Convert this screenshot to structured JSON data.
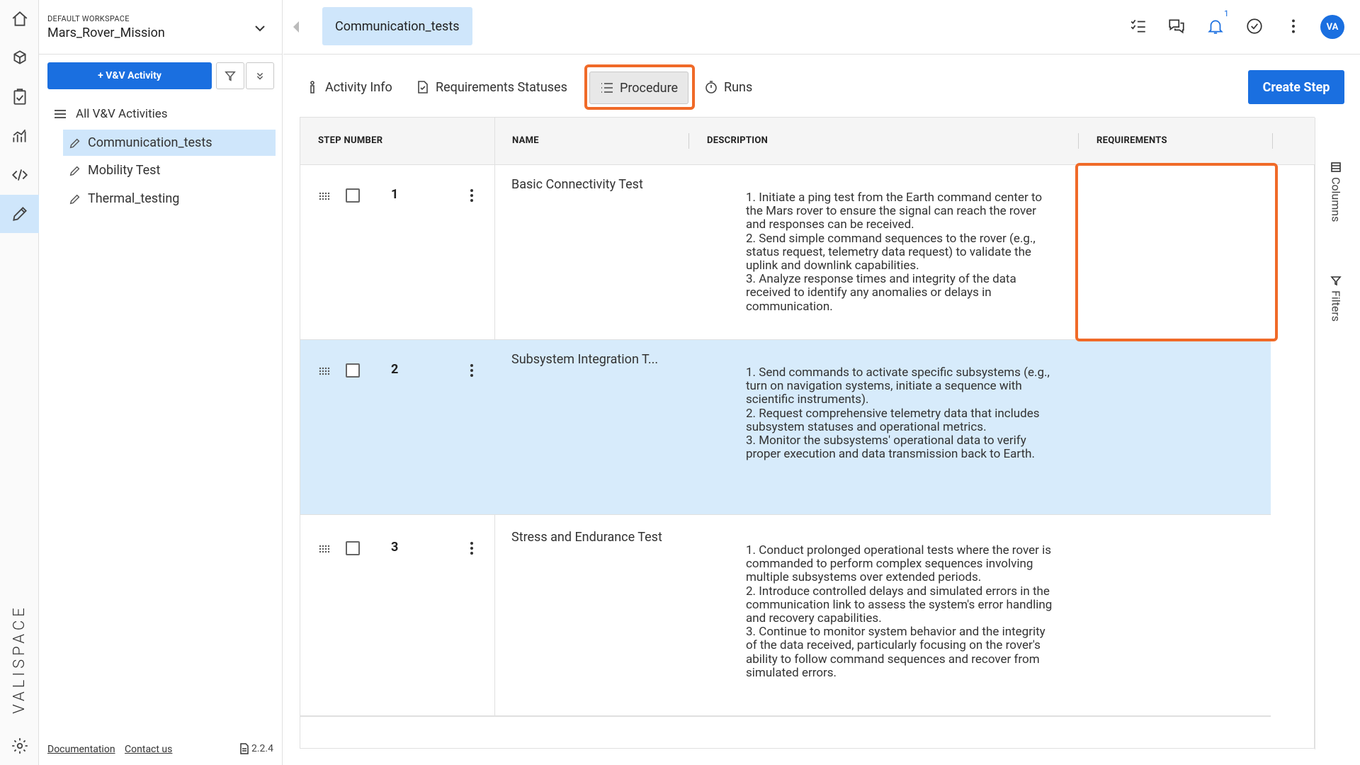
{
  "rail": {
    "icons": [
      "home-icon",
      "cube-icon",
      "clipboard-icon",
      "analytics-icon",
      "code-icon",
      "pencil-icon"
    ],
    "logo": "VALISPACE",
    "settings_icon": "gear-icon"
  },
  "sidebar": {
    "workspace_label": "DEFAULT WORKSPACE",
    "workspace_name": "Mars_Rover_Mission",
    "add_button_label": "+ V&V Activity",
    "tree_root": "All V&V Activities",
    "items": [
      {
        "label": "Communication_tests",
        "selected": true
      },
      {
        "label": "Mobility Test",
        "selected": false
      },
      {
        "label": "Thermal_testing",
        "selected": false
      }
    ],
    "footer": {
      "documentation": "Documentation",
      "contact": "Contact us",
      "version": "2.2.4"
    }
  },
  "topbar": {
    "active_tab": "Communication_tests",
    "notification_count": "1",
    "avatar_initials": "VA"
  },
  "subtabs": [
    {
      "label": "Activity Info",
      "icon": "person-icon"
    },
    {
      "label": "Requirements Statuses",
      "icon": "doc-check-icon"
    },
    {
      "label": "Procedure",
      "icon": "list-icon",
      "active": true
    },
    {
      "label": "Runs",
      "icon": "timer-icon"
    }
  ],
  "create_button_label": "Create Step",
  "table": {
    "headers": {
      "step_number": "STEP NUMBER",
      "name": "NAME",
      "description": "DESCRIPTION",
      "requirements": "REQUIREMENTS"
    },
    "rows": [
      {
        "number": "1",
        "name": "Basic Connectivity Test",
        "desc_1": "1.  Initiate a ping test from the Earth command center to the Mars rover to ensure the signal can reach the rover and responses can be received.",
        "desc_2": "2.  Send simple command sequences to the rover (e.g., status request, telemetry data request) to validate the uplink and downlink capabilities.",
        "desc_3": "3.  Analyze response times and integrity of the data received to identify any anomalies or delays in communication."
      },
      {
        "number": "2",
        "name": "Subsystem Integration T...",
        "desc_1": "1.  Send commands to activate specific subsystems (e.g., turn on navigation systems, initiate a sequence with scientific instruments).",
        "desc_2": "2.  Request comprehensive telemetry data that includes subsystem statuses and operational metrics.",
        "desc_3": "3.  Monitor the subsystems' operational data to verify proper execution and data transmission back to Earth."
      },
      {
        "number": "3",
        "name": "Stress and Endurance Test",
        "desc_1": "1.  Conduct prolonged operational tests where the rover is commanded to perform complex sequences involving multiple subsystems over extended periods.",
        "desc_2": "2.  Introduce controlled delays and simulated errors in the communication link to assess the system's error handling and recovery capabilities.",
        "desc_3": "3.  Continue to monitor system behavior and the integrity of the data received, particularly focusing on the rover's ability to follow command sequences and recover from simulated errors."
      }
    ]
  },
  "side_panel": {
    "columns": "Columns",
    "filters": "Filters"
  },
  "colors": {
    "accent": "#1a6fe0",
    "selected_bg": "#cfe6fb",
    "highlight": "#f06a28"
  }
}
